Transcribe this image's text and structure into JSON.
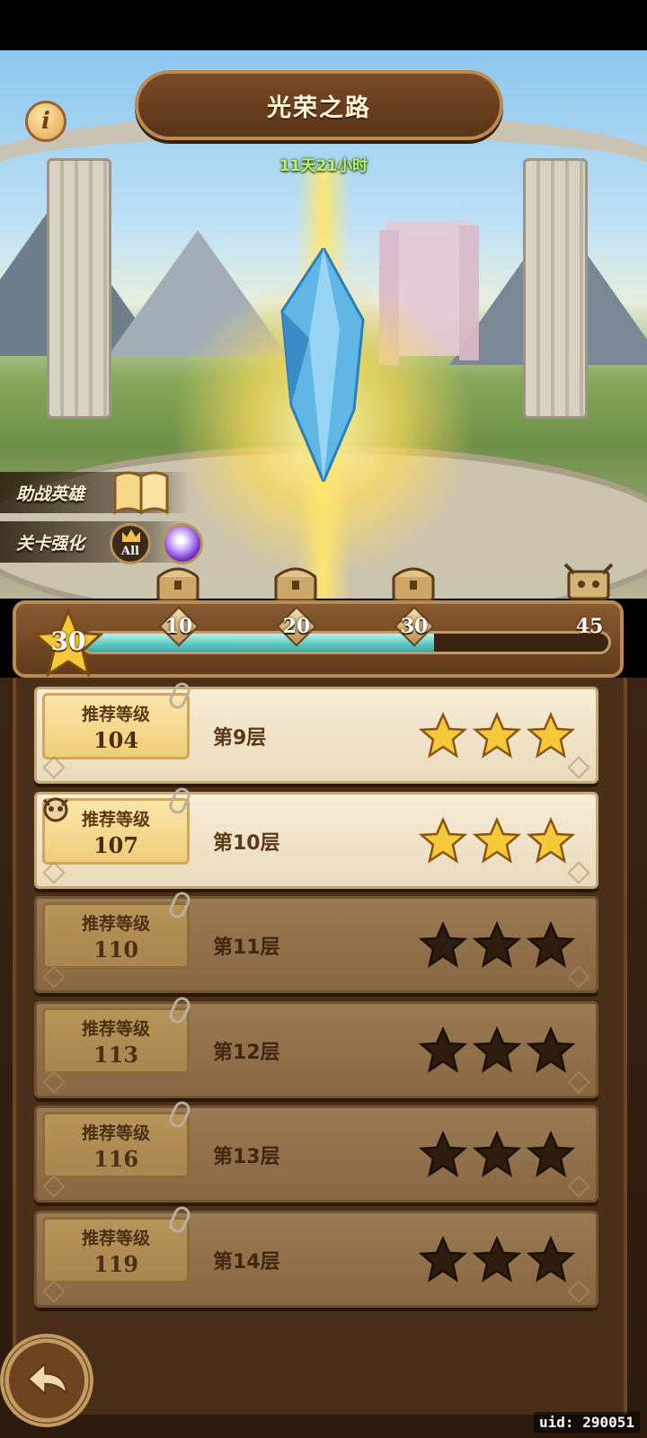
{
  "header": {
    "title": "光荣之路",
    "info_icon": "info-icon",
    "info_label": "i",
    "timer": "11天21小时"
  },
  "side_buttons": {
    "helper_heroes": "助战英雄",
    "stage_boost": "关卡强化",
    "all_badge": "All"
  },
  "progress": {
    "current_stars": "30",
    "max_stars": "45",
    "fill_fraction": 0.667,
    "milestones": [
      "10",
      "20",
      "30",
      "45"
    ]
  },
  "floors": [
    {
      "label": "推荐等级",
      "level": "104",
      "name": "第9层",
      "stars": 3,
      "locked": false,
      "boss": false
    },
    {
      "label": "推荐等级",
      "level": "107",
      "name": "第10层",
      "stars": 3,
      "locked": false,
      "boss": true
    },
    {
      "label": "推荐等级",
      "level": "110",
      "name": "第11层",
      "stars": 0,
      "locked": true,
      "boss": false
    },
    {
      "label": "推荐等级",
      "level": "113",
      "name": "第12层",
      "stars": 0,
      "locked": true,
      "boss": false
    },
    {
      "label": "推荐等级",
      "level": "116",
      "name": "第13层",
      "stars": 0,
      "locked": true,
      "boss": false
    },
    {
      "label": "推荐等级",
      "level": "119",
      "name": "第14层",
      "stars": 0,
      "locked": true,
      "boss": false
    }
  ],
  "footer": {
    "uid": "uid: 290051"
  },
  "colors": {
    "gold_star": "#f6c93a",
    "empty_star": "#2e1d0f",
    "progress_fill": "#5fc6c0"
  }
}
